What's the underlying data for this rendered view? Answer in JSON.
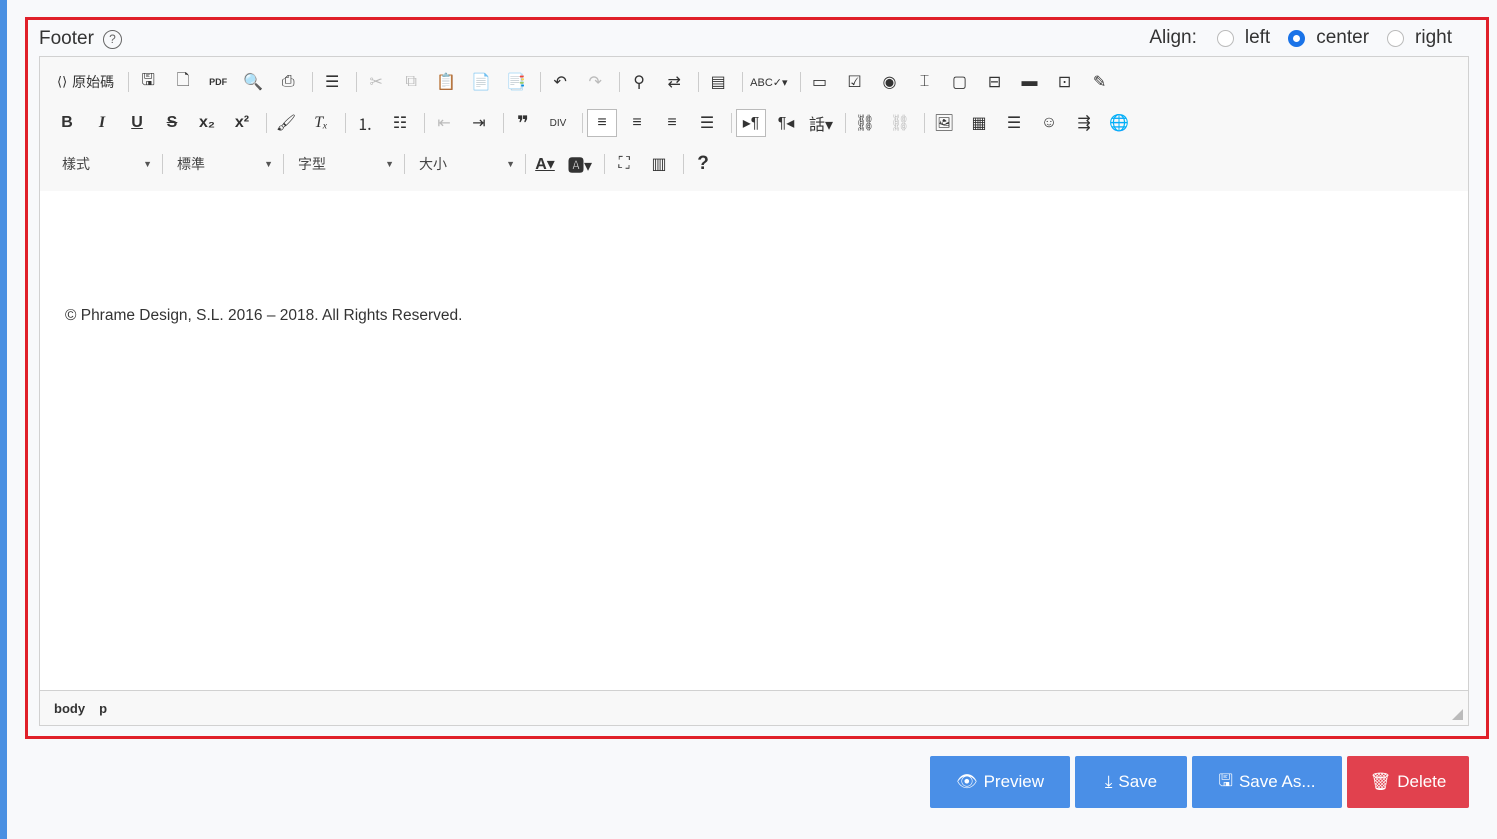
{
  "field": {
    "label": "Footer",
    "help_glyph": "?"
  },
  "align": {
    "label": "Align:",
    "options": [
      "left",
      "center",
      "right"
    ],
    "selected": "center"
  },
  "toolbar": {
    "source_label": "原始碼",
    "styles_combo": "樣式",
    "format_combo": "標準",
    "font_combo": "字型",
    "size_combo": "大小",
    "help_glyph": "?"
  },
  "content": {
    "text": "© Phrame Design, S.L. 2016 – 2018. All Rights Reserved."
  },
  "path": [
    "body",
    "p"
  ],
  "buttons": {
    "preview": "Preview",
    "save": "Save",
    "save_as": "Save As...",
    "delete": "Delete"
  },
  "colors": {
    "panel_border": "#e0202a",
    "rail": "#4a90e2",
    "primary": "#4a8fe7",
    "danger": "#e1414e",
    "radio_checked": "#1a73e8"
  }
}
